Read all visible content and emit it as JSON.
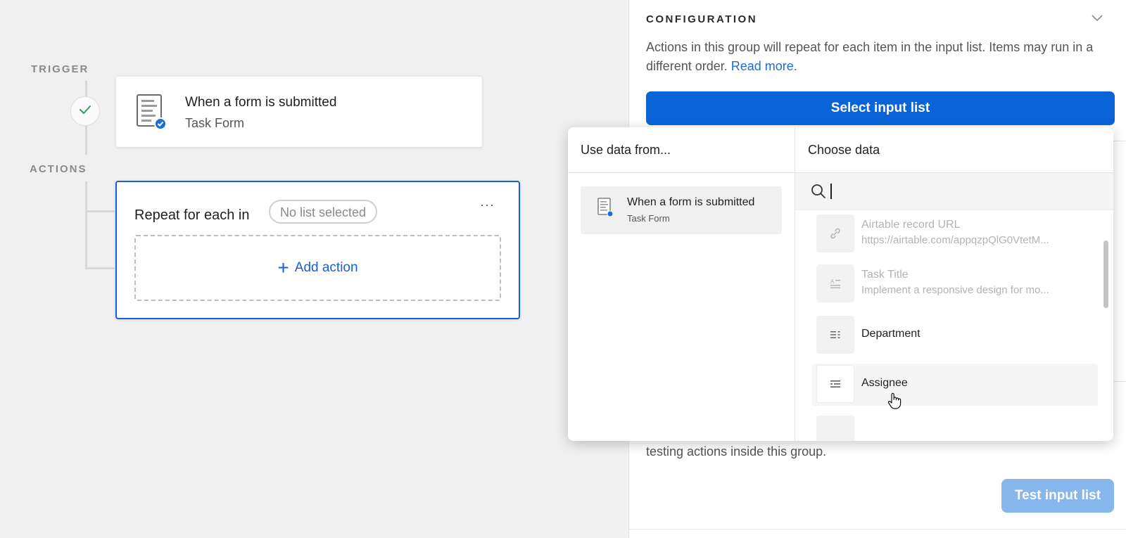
{
  "canvas": {
    "trigger_label": "TRIGGER",
    "actions_label": "ACTIONS",
    "trigger_card": {
      "title": "When a form is submitted",
      "subtitle": "Task Form"
    },
    "repeat_card": {
      "title": "Repeat for each in",
      "list_pill": "No list selected",
      "more_label": "···",
      "add_action_label": "Add action"
    }
  },
  "config": {
    "title": "CONFIGURATION",
    "description": "Actions in this group will repeat for each item in the input list. Items may run in a different order.",
    "read_more": "Read more.",
    "select_button": "Select input list",
    "testing_text": "testing actions inside this group.",
    "test_button": "Test input list"
  },
  "popover": {
    "left_header": "Use data from...",
    "right_header": "Choose data",
    "source": {
      "title": "When a form is submitted",
      "subtitle": "Task Form"
    },
    "search": {
      "value": "",
      "placeholder": ""
    },
    "fields": [
      {
        "name": "Airtable record URL",
        "value": "https://airtable.com/appqzpQlG0VtetM...",
        "icon": "link-icon",
        "faded": true
      },
      {
        "name": "Task Title",
        "value": "Implement a responsive design for mo...",
        "icon": "text-field-icon",
        "faded": true
      },
      {
        "name": "Department",
        "value": "",
        "icon": "select-field-icon",
        "faded": false
      },
      {
        "name": "Assignee",
        "value": "",
        "icon": "user-field-icon",
        "faded": false,
        "hovered": true
      }
    ]
  },
  "colors": {
    "accent": "#0a64d8",
    "accent_light": "#86b6ec",
    "link": "#1a6fd6",
    "selection_border": "#1a5dd4",
    "canvas_bg": "#f0f0f0"
  }
}
